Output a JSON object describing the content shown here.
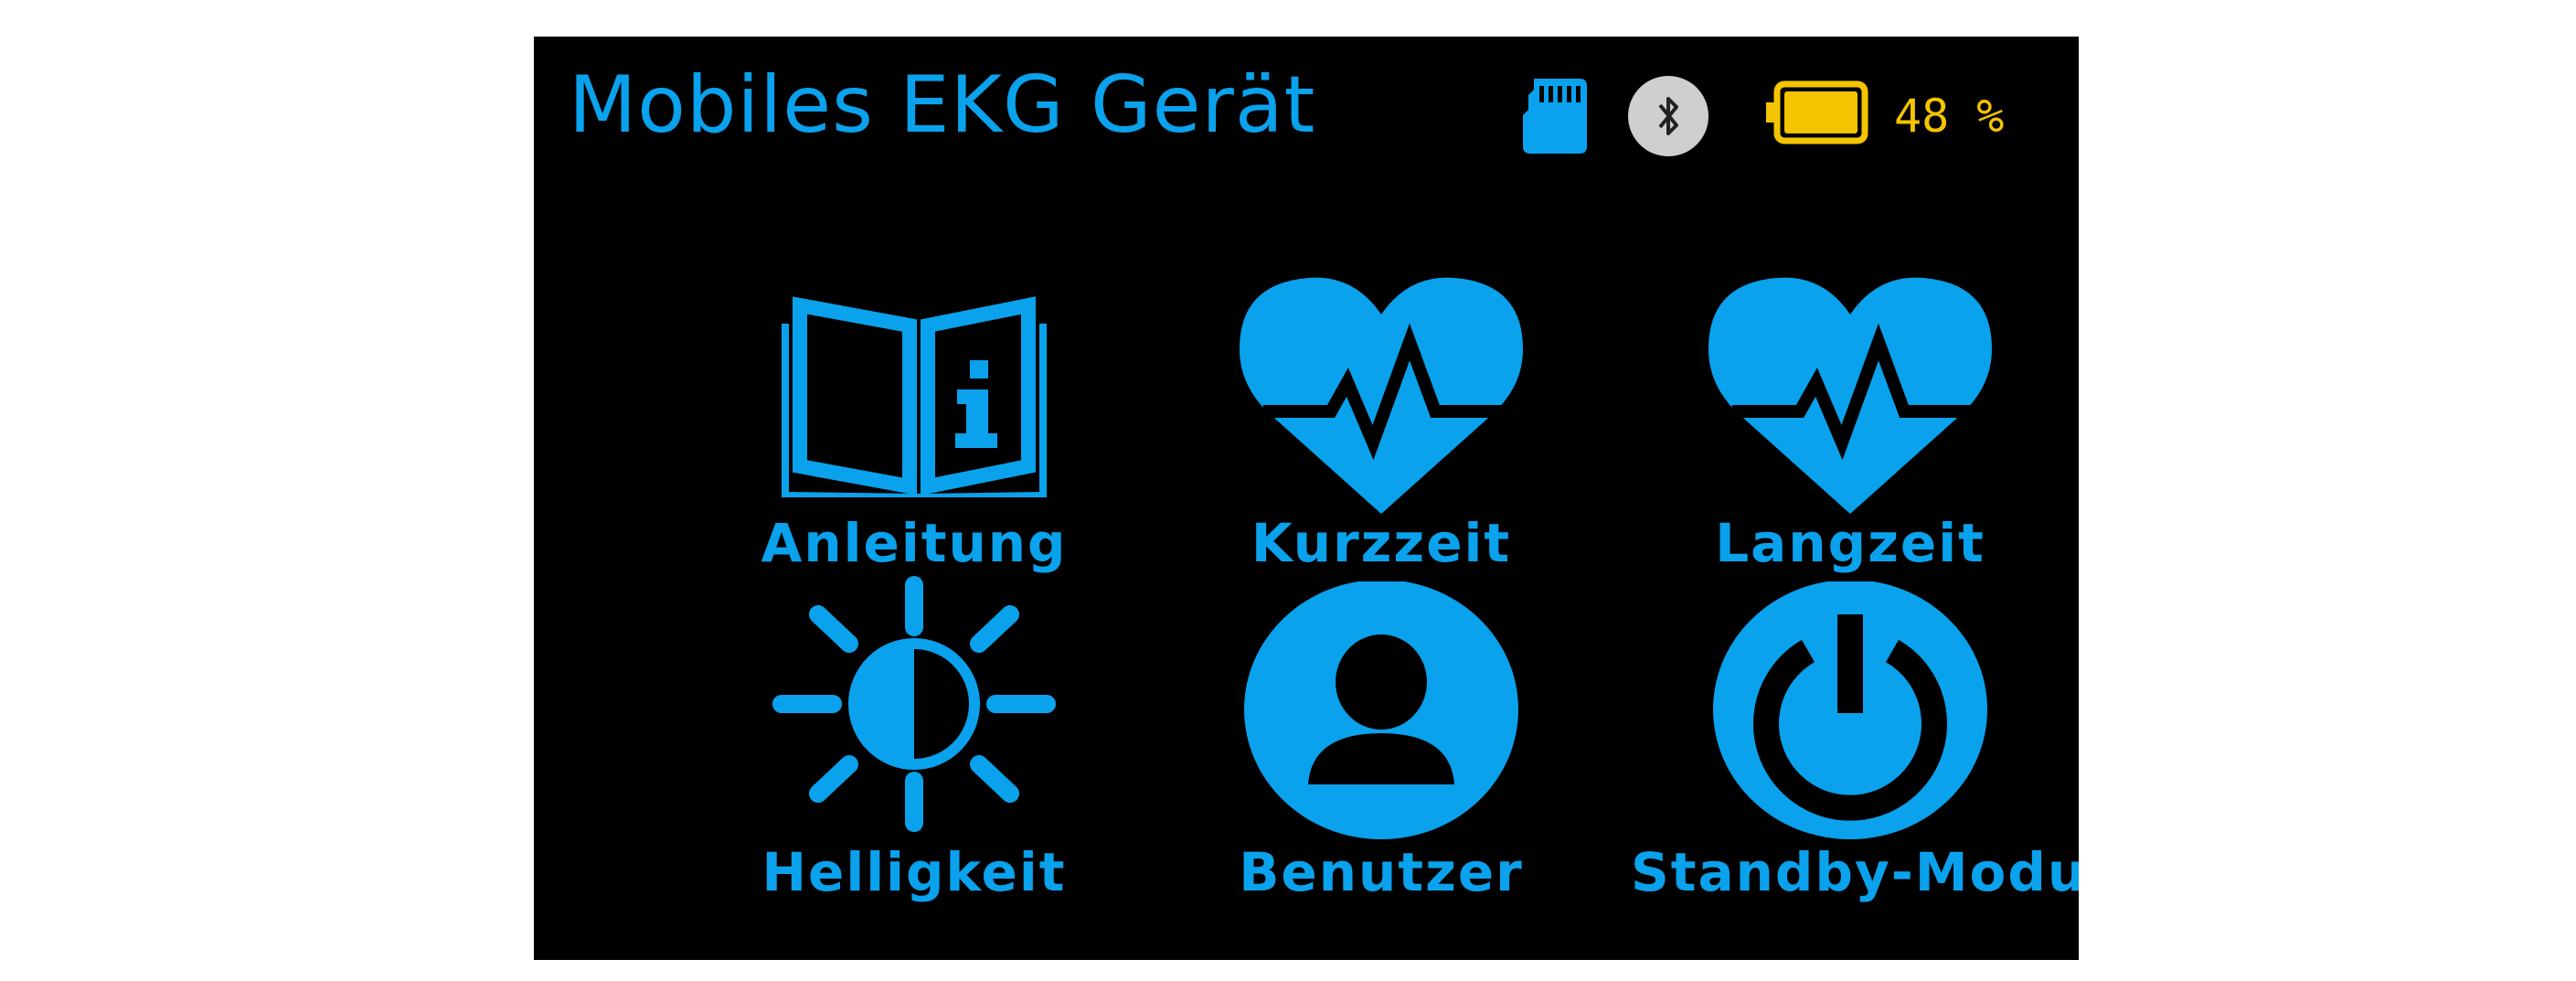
{
  "header": {
    "title": "Mobiles EKG Gerät",
    "battery_level": 48,
    "battery_text": "48 %",
    "icons": [
      "sd-card-icon",
      "bluetooth-icon",
      "battery-icon"
    ]
  },
  "menu": {
    "items": [
      {
        "label": "Anleitung",
        "icon": "manual-book-icon"
      },
      {
        "label": "Kurzzeit",
        "icon": "heart-ecg-icon"
      },
      {
        "label": "Langzeit",
        "icon": "heart-ecg-icon"
      },
      {
        "label": "Helligkeit",
        "icon": "brightness-sun-icon"
      },
      {
        "label": "Benutzer",
        "icon": "user-icon"
      },
      {
        "label": "Standby-Modus",
        "icon": "power-icon"
      }
    ]
  },
  "colors": {
    "accent": "#0aa2ec",
    "battery": "#f5c400",
    "background": "#000000",
    "bluetooth_bg": "#cfcfcf"
  }
}
